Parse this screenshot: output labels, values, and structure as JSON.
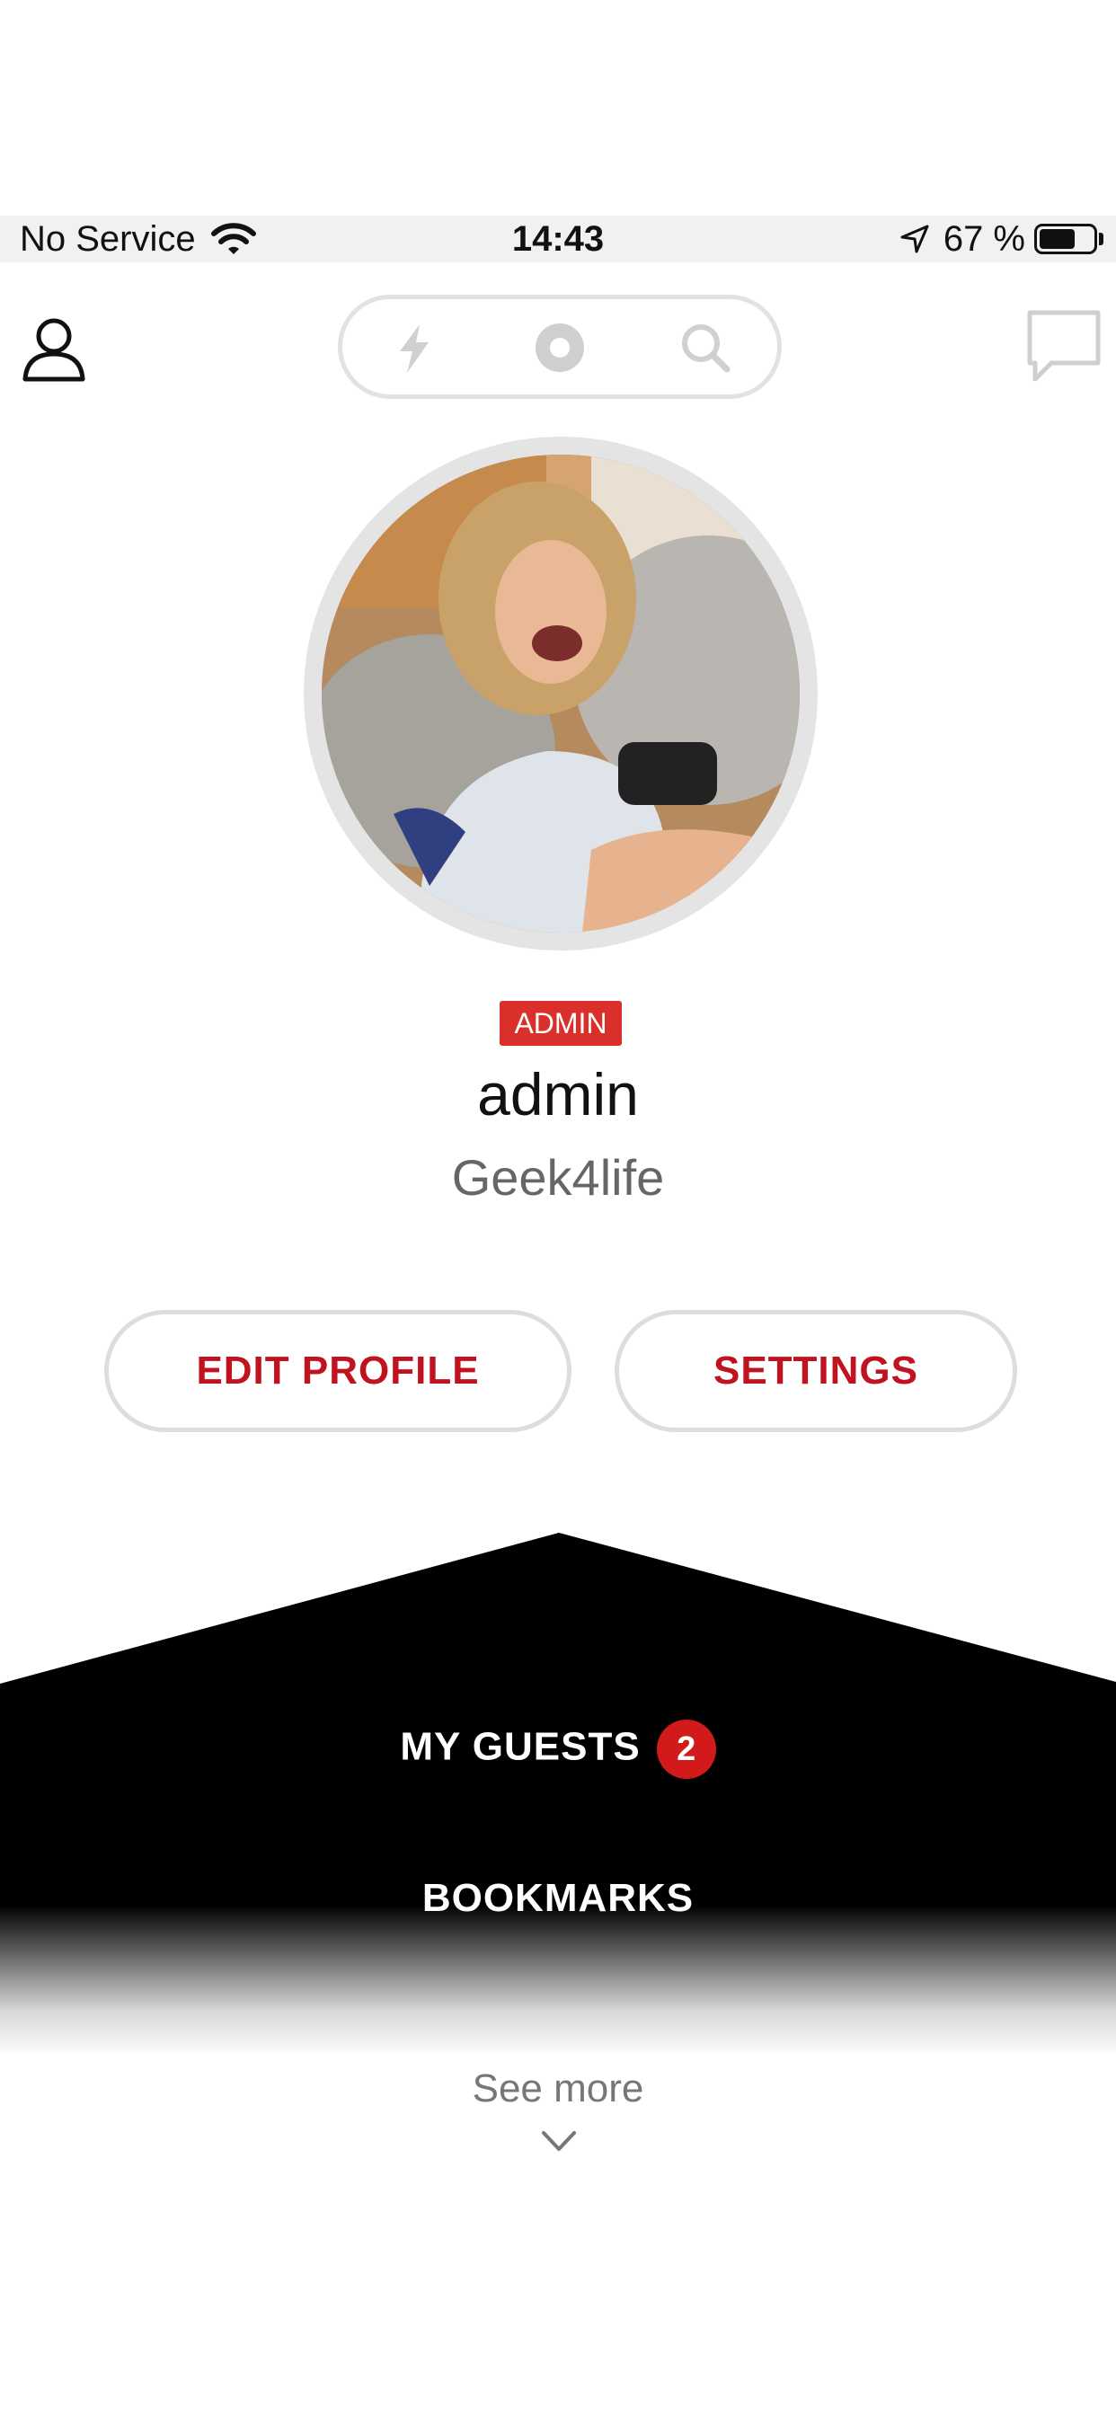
{
  "status_bar": {
    "carrier": "No Service",
    "time": "14:43",
    "battery_text": "67 %",
    "battery_level": 0.67
  },
  "header": {
    "icons": [
      "user-icon",
      "bolt-icon",
      "record-icon",
      "search-icon",
      "chat-icon"
    ]
  },
  "profile": {
    "role_badge": "ADMIN",
    "username": "admin",
    "tagline": "Geek4life"
  },
  "actions": {
    "edit_profile": "EDIT PROFILE",
    "settings": "SETTINGS"
  },
  "menu": {
    "items": [
      {
        "label": "MY GUESTS",
        "count": "2"
      },
      {
        "label": "BOOKMARKS"
      }
    ],
    "see_more": "See more"
  },
  "colors": {
    "accent": "#c1121f",
    "badge": "#d9302b",
    "menu_bg": "#000000"
  }
}
